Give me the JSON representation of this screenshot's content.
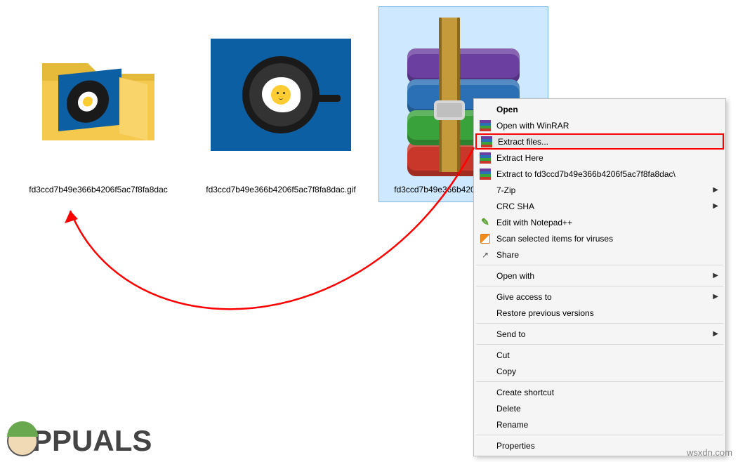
{
  "files": {
    "folder": {
      "label": "fd3ccd7b49e366b4206f5ac7f8fa8dac"
    },
    "gif": {
      "label": "fd3ccd7b49e366b4206f5ac7f8fa8dac.gif"
    },
    "rar": {
      "label": "fd3ccd7b49e366b4206f5ac7f8fa8dac"
    }
  },
  "menu": {
    "open": "Open",
    "openWithWinrar": "Open with WinRAR",
    "extractFiles": "Extract files...",
    "extractHere": "Extract Here",
    "extractTo": "Extract to fd3ccd7b49e366b4206f5ac7f8fa8dac\\",
    "sevenZip": "7-Zip",
    "crcSha": "CRC SHA",
    "editNpp": "Edit with Notepad++",
    "scanViruses": "Scan selected items for viruses",
    "share": "Share",
    "openWith": "Open with",
    "giveAccess": "Give access to",
    "restore": "Restore previous versions",
    "sendTo": "Send to",
    "cut": "Cut",
    "copy": "Copy",
    "createShortcut": "Create shortcut",
    "delete": "Delete",
    "rename": "Rename",
    "properties": "Properties"
  },
  "logo": {
    "text": "PPUALS"
  },
  "watermark": "wsxdn.com"
}
